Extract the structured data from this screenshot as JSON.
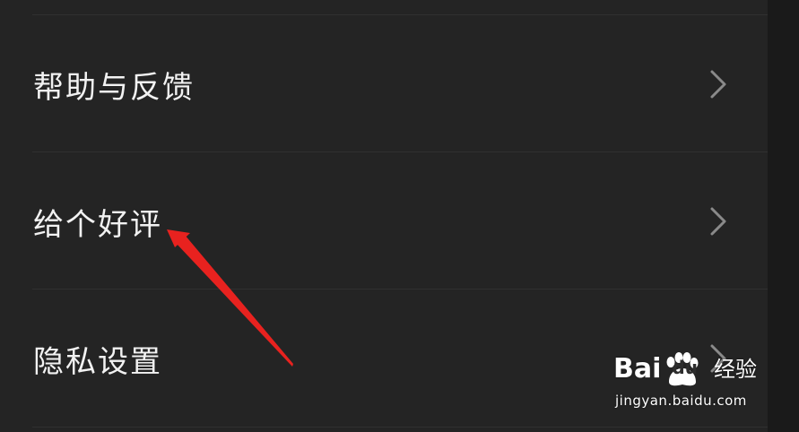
{
  "settings_menu": {
    "items": [
      {
        "label": "帮助与反馈",
        "chevron": "chevron-right-icon"
      },
      {
        "label": "给个好评",
        "chevron": "chevron-right-icon"
      },
      {
        "label": "隐私设置",
        "chevron": "chevron-right-icon"
      }
    ]
  },
  "annotation": {
    "arrow_color": "#e8221f"
  },
  "watermark": {
    "brand_left": "Bai",
    "brand_right": "du",
    "brand_suffix": "经验",
    "url": "jingyan.baidu.com"
  },
  "colors": {
    "background": "#242424",
    "text": "#f2f2f2",
    "divider": "#303030",
    "chevron": "#8a8a8a"
  }
}
